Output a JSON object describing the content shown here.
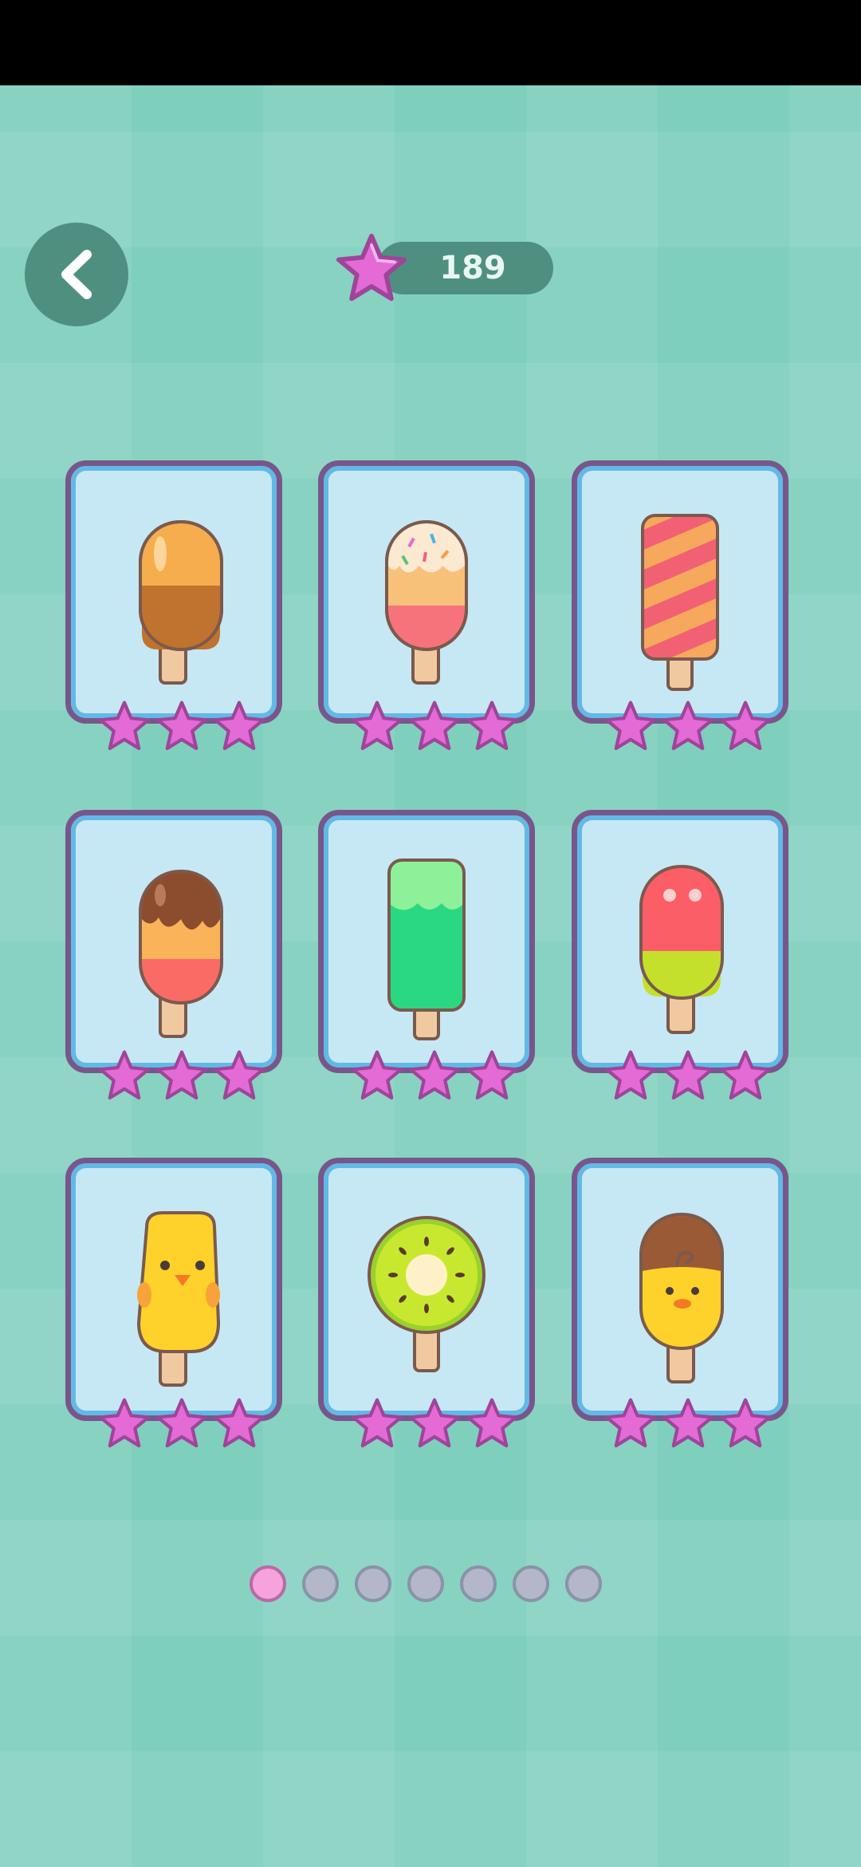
{
  "header": {
    "back_icon": "chevron-left-icon",
    "star_count": "189",
    "currency_icon": "star-icon"
  },
  "colors": {
    "background": "#7fcfbd",
    "card_fill": "#c6e8f4",
    "card_border": "#77578b",
    "star": "#e46bd6",
    "active_dot": "#f5a3da",
    "inactive_dot": "#b3b7c9"
  },
  "levels": [
    {
      "name": "orange-chocolate-popsicle",
      "stars": 3
    },
    {
      "name": "sprinkle-popsicle",
      "stars": 3
    },
    {
      "name": "striped-popsicle",
      "stars": 3
    },
    {
      "name": "chocolate-dip-popsicle",
      "stars": 3
    },
    {
      "name": "green-popsicle",
      "stars": 3
    },
    {
      "name": "watermelon-popsicle",
      "stars": 3
    },
    {
      "name": "chick-popsicle",
      "stars": 3
    },
    {
      "name": "kiwi-popsicle",
      "stars": 3
    },
    {
      "name": "chocolate-chick-popsicle",
      "stars": 3
    }
  ],
  "pagination": {
    "total_pages": 7,
    "current_page": 1
  }
}
